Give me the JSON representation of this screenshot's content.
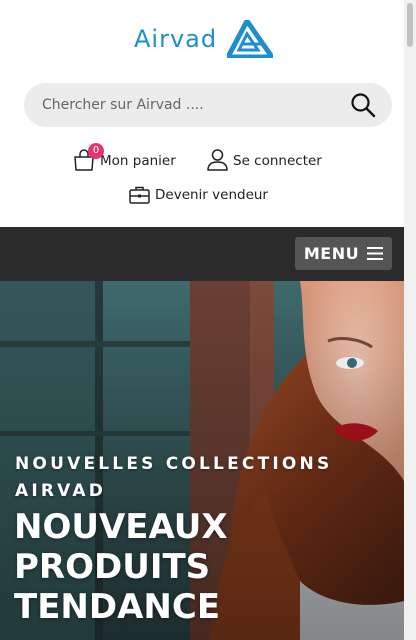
{
  "brand": {
    "name": "Airvad",
    "color": "#1d8ecf"
  },
  "search": {
    "placeholder": "Chercher sur Airvad ...."
  },
  "header_links": {
    "cart_label": "Mon panier",
    "cart_count": "0",
    "login_label": "Se connecter",
    "seller_label": "Devenir vendeur"
  },
  "nav": {
    "menu_label": "MENU"
  },
  "hero": {
    "kicker": "NOUVELLES COLLECTIONS AIRVAD",
    "title": "NOUVEAUX PRODUITS TENDANCE"
  },
  "colors": {
    "accent": "#1d8ecf",
    "badge": "#e8336d",
    "navbar": "#2b2b2b",
    "menu_button": "#555555"
  },
  "icons": [
    "logo-mark-icon",
    "search-icon",
    "shopping-bag-icon",
    "user-icon",
    "briefcase-icon",
    "hamburger-icon"
  ]
}
